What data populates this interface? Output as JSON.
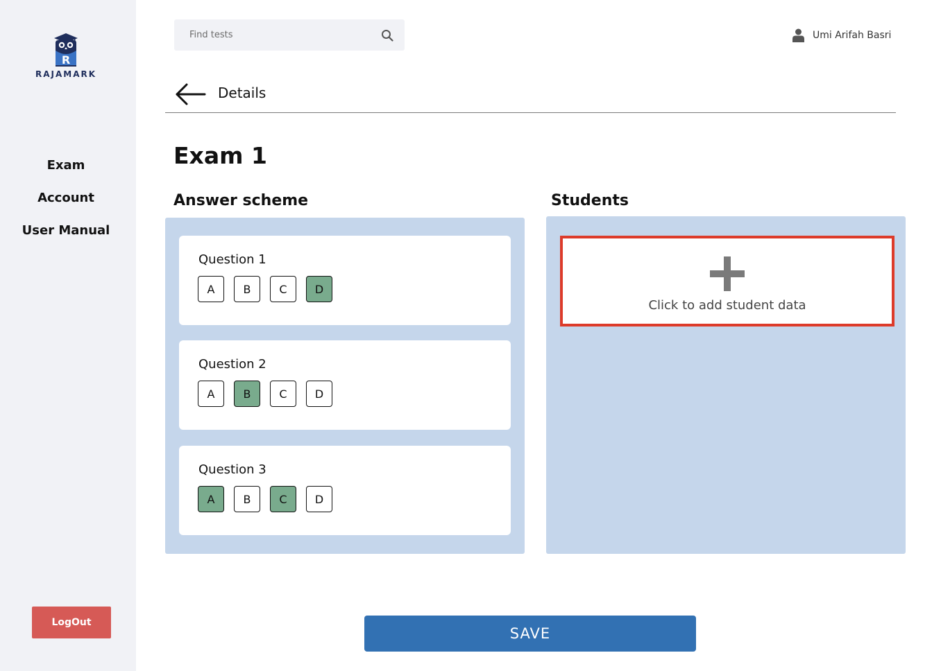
{
  "app": {
    "brand": "RAJAMARK"
  },
  "sidebar": {
    "items": [
      {
        "label": "Exam"
      },
      {
        "label": "Account"
      },
      {
        "label": "User Manual"
      }
    ],
    "logout_label": "LogOut"
  },
  "header": {
    "search": {
      "placeholder": "Find tests",
      "icon": "search-icon"
    },
    "user": {
      "name": "Umi Arifah Basri",
      "icon": "user-icon"
    }
  },
  "page": {
    "breadcrumb_title": "Details",
    "exam_title": "Exam 1"
  },
  "answer_scheme": {
    "title": "Answer scheme",
    "questions": [
      {
        "label": "Question 1",
        "options": [
          "A",
          "B",
          "C",
          "D"
        ],
        "selected": [
          "D"
        ]
      },
      {
        "label": "Question 2",
        "options": [
          "A",
          "B",
          "C",
          "D"
        ],
        "selected": [
          "B"
        ]
      },
      {
        "label": "Question 3",
        "options": [
          "A",
          "B",
          "C",
          "D"
        ],
        "selected": [
          "A",
          "C"
        ]
      }
    ]
  },
  "students": {
    "title": "Students",
    "add_label": "Click to add student data"
  },
  "actions": {
    "save_label": "SAVE"
  },
  "colors": {
    "sidebar_bg": "#f1f2f6",
    "panel_bg": "#c5d6eb",
    "selected_option": "#79ab8d",
    "highlight_border": "#dd3b2a",
    "save_button": "#3271b3",
    "logout_button": "#d65a56",
    "brand_navy": "#1f2e5c"
  }
}
